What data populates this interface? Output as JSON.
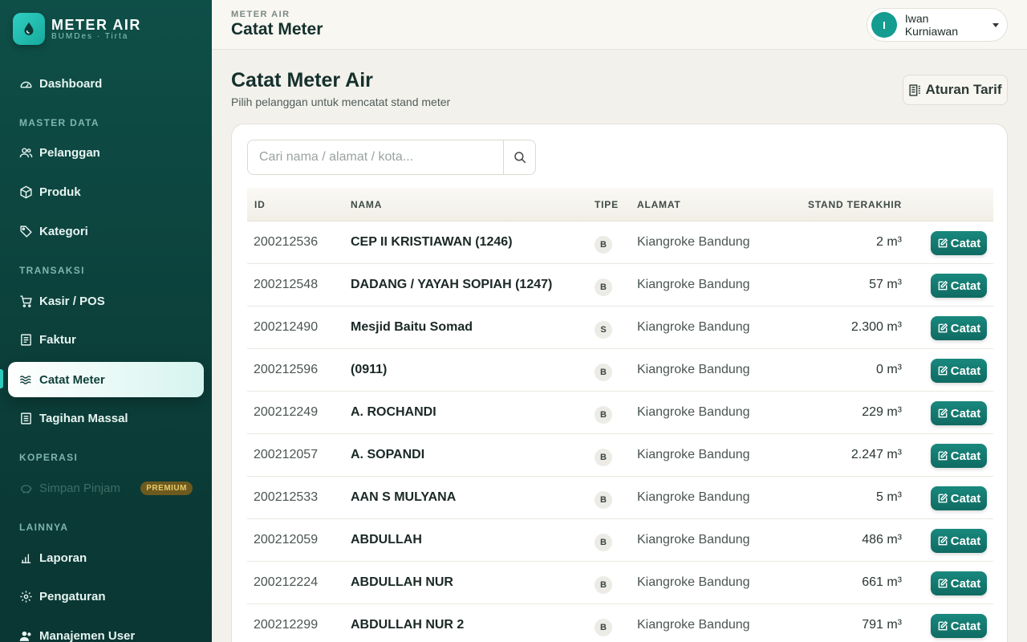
{
  "brand": {
    "name": "METER AIR",
    "subtitle": "BUMDes · Tirta"
  },
  "sidebar": {
    "dashboard": "Dashboard",
    "section_master": "MASTER DATA",
    "pelanggan": "Pelanggan",
    "produk": "Produk",
    "kategori": "Kategori",
    "section_transaksi": "TRANSAKSI",
    "kasir": "Kasir / POS",
    "faktur": "Faktur",
    "catat_meter": "Catat Meter",
    "tagihan": "Tagihan Massal",
    "section_koperasi": "KOPERASI",
    "simpan_pinjam": "Simpan Pinjam",
    "premium_badge": "PREMIUM",
    "section_lainnya": "LAINNYA",
    "laporan": "Laporan",
    "pengaturan": "Pengaturan",
    "manajemen_user": "Manajemen User"
  },
  "header": {
    "crumb": "METER AIR",
    "title": "Catat Meter"
  },
  "user": {
    "initial": "I",
    "name": "Iwan Kurniawan"
  },
  "main": {
    "title": "Catat Meter Air",
    "subtitle": "Pilih pelanggan untuk mencatat stand meter",
    "tarif_button": "Aturan Tarif",
    "search_placeholder": "Cari nama / alamat / kota..."
  },
  "table": {
    "headers": {
      "id": "ID",
      "name": "NAMA",
      "type": "TIPE",
      "address": "ALAMAT",
      "stand": "STAND TERAKHIR"
    },
    "action_label": "Catat",
    "rows": [
      {
        "id": "200212536",
        "name": "CEP II KRISTIAWAN (1246)",
        "type": "B",
        "address": "Kiangroke Bandung",
        "stand": "2 m³"
      },
      {
        "id": "200212548",
        "name": "DADANG / YAYAH SOPIAH (1247)",
        "type": "B",
        "address": "Kiangroke Bandung",
        "stand": "57 m³"
      },
      {
        "id": "200212490",
        "name": "Mesjid Baitu Somad",
        "type": "S",
        "address": "Kiangroke Bandung",
        "stand": "2.300 m³"
      },
      {
        "id": "200212596",
        "name": "(0911)",
        "type": "B",
        "address": "Kiangroke Bandung",
        "stand": "0 m³"
      },
      {
        "id": "200212249",
        "name": "A. ROCHANDI",
        "type": "B",
        "address": "Kiangroke Bandung",
        "stand": "229 m³"
      },
      {
        "id": "200212057",
        "name": "A. SOPANDI",
        "type": "B",
        "address": "Kiangroke Bandung",
        "stand": "2.247 m³"
      },
      {
        "id": "200212533",
        "name": "AAN S MULYANA",
        "type": "B",
        "address": "Kiangroke Bandung",
        "stand": "5 m³"
      },
      {
        "id": "200212059",
        "name": "ABDULLAH",
        "type": "B",
        "address": "Kiangroke Bandung",
        "stand": "486 m³"
      },
      {
        "id": "200212224",
        "name": "ABDULLAH NUR",
        "type": "B",
        "address": "Kiangroke Bandung",
        "stand": "661 m³"
      },
      {
        "id": "200212299",
        "name": "ABDULLAH NUR 2",
        "type": "B",
        "address": "Kiangroke Bandung",
        "stand": "791 m³"
      }
    ]
  }
}
